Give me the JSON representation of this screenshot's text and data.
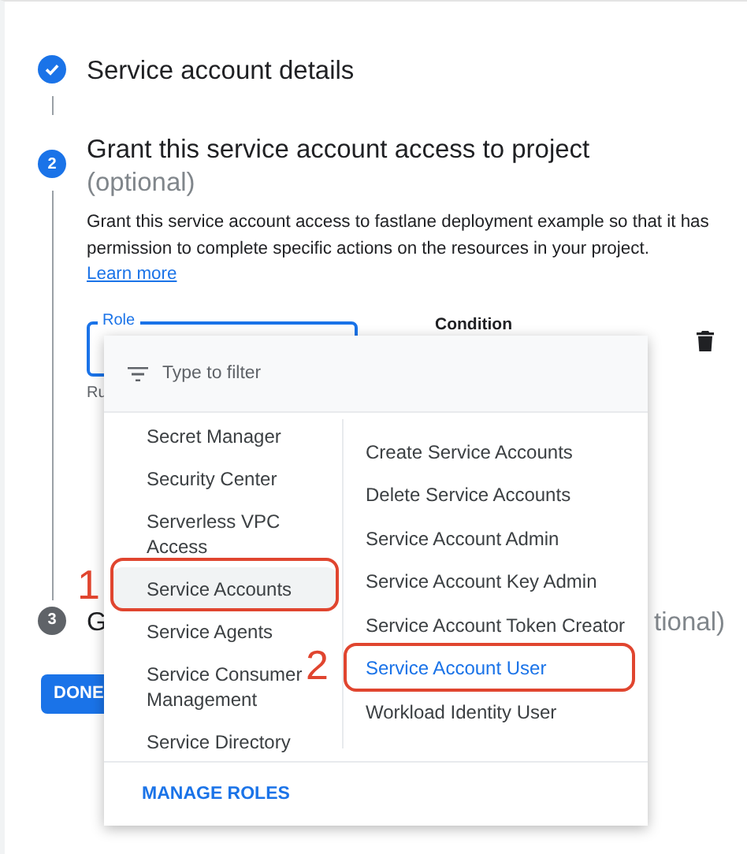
{
  "steps": [
    {
      "kind": "done",
      "title": "Service account details"
    },
    {
      "kind": "active",
      "number": "2",
      "title": "Grant this service account access to project",
      "subtitle": "(optional)"
    },
    {
      "kind": "pending",
      "number": "3",
      "title": "G",
      "title_end": "tional)"
    }
  ],
  "description": "Grant this service account access to fastlane deployment example so that it has permission to complete specific actions on the resources in your project.",
  "learn_more": "Learn more",
  "role_field": {
    "label": "Role",
    "helper": "Ru"
  },
  "condition_label": "Condition",
  "done_button": "DONE",
  "menu": {
    "filter_placeholder": "Type to filter",
    "categories": [
      {
        "label": "Secret Manager",
        "selected": false
      },
      {
        "label": "Security Center",
        "selected": false
      },
      {
        "label": "Serverless VPC Access",
        "selected": false
      },
      {
        "label": "Service Accounts",
        "selected": true,
        "callout": "1"
      },
      {
        "label": "Service Agents",
        "selected": false
      },
      {
        "label": "Service Consumer Management",
        "selected": false
      },
      {
        "label": "Service Directory",
        "selected": false
      }
    ],
    "roles": [
      {
        "label": "Create Service Accounts",
        "selected": false
      },
      {
        "label": "Delete Service Accounts",
        "selected": false
      },
      {
        "label": "Service Account Admin",
        "selected": false
      },
      {
        "label": "Service Account Key Admin",
        "selected": false
      },
      {
        "label": "Service Account Token Creator",
        "selected": false
      },
      {
        "label": "Service Account User",
        "selected": true,
        "callout": "2"
      },
      {
        "label": "Workload Identity User",
        "selected": false
      }
    ],
    "footer": "MANAGE ROLES"
  }
}
